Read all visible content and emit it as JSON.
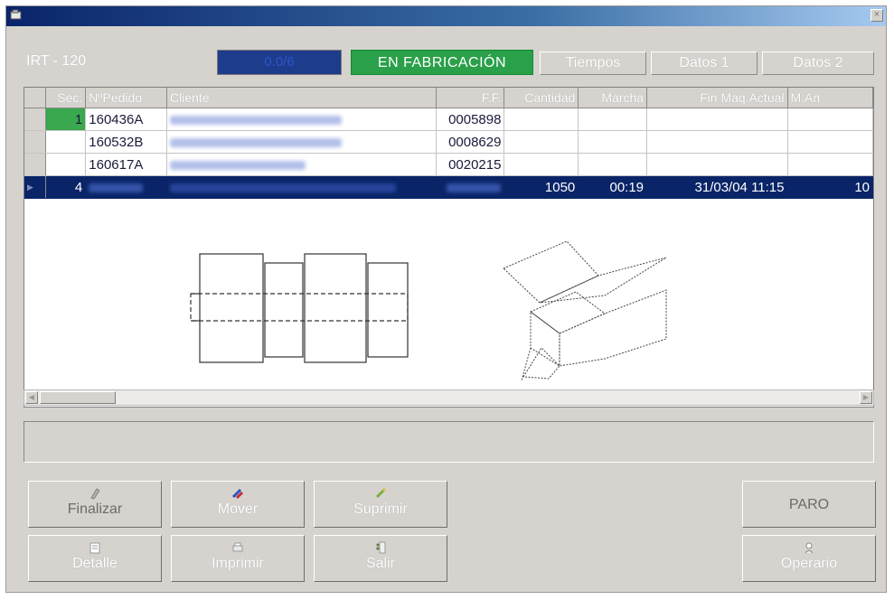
{
  "window": {
    "machine": "IRT - 120",
    "progress": "0.0/6",
    "status": "EN FABRICACIÓN",
    "status_color": "#2aa04a",
    "tabs": [
      "Tiempos",
      "Datos 1",
      "Datos 2"
    ]
  },
  "grid": {
    "headers": [
      "Sec.",
      "NºPedido",
      "Cliente",
      "F.F.",
      "Cantidad",
      "Marcha",
      "Fin Maq.Actual",
      "M.An"
    ],
    "rows": [
      {
        "sec": "1",
        "pedido": "160436A",
        "ff": "0005898",
        "cantidad": "",
        "marcha": "",
        "fin": "",
        "man": ""
      },
      {
        "sec": "",
        "pedido": "160532B",
        "ff": "0008629",
        "cantidad": "",
        "marcha": "",
        "fin": "",
        "man": ""
      },
      {
        "sec": "",
        "pedido": "160617A",
        "ff": "0020215",
        "cantidad": "",
        "marcha": "",
        "fin": "",
        "man": ""
      },
      {
        "sec": "4",
        "pedido": "",
        "ff": "",
        "cantidad": "1050",
        "marcha": "00:19",
        "fin": "31/03/04 11:15",
        "man": "10"
      }
    ]
  },
  "selection_color": "#0a2468",
  "buttons": {
    "finalizar": "Finalizar",
    "mover": "Mover",
    "suprimir": "Suprimir",
    "detalle": "Detalle",
    "imprimir": "Imprimir",
    "salir": "Salir",
    "paro": "PARO",
    "operario": "Operario"
  },
  "icons": [
    "app-icon",
    "close-icon",
    "finalizar-icon",
    "mover-icon",
    "suprimir-icon",
    "detalle-icon",
    "imprimir-icon",
    "salir-icon",
    "operario-icon"
  ]
}
